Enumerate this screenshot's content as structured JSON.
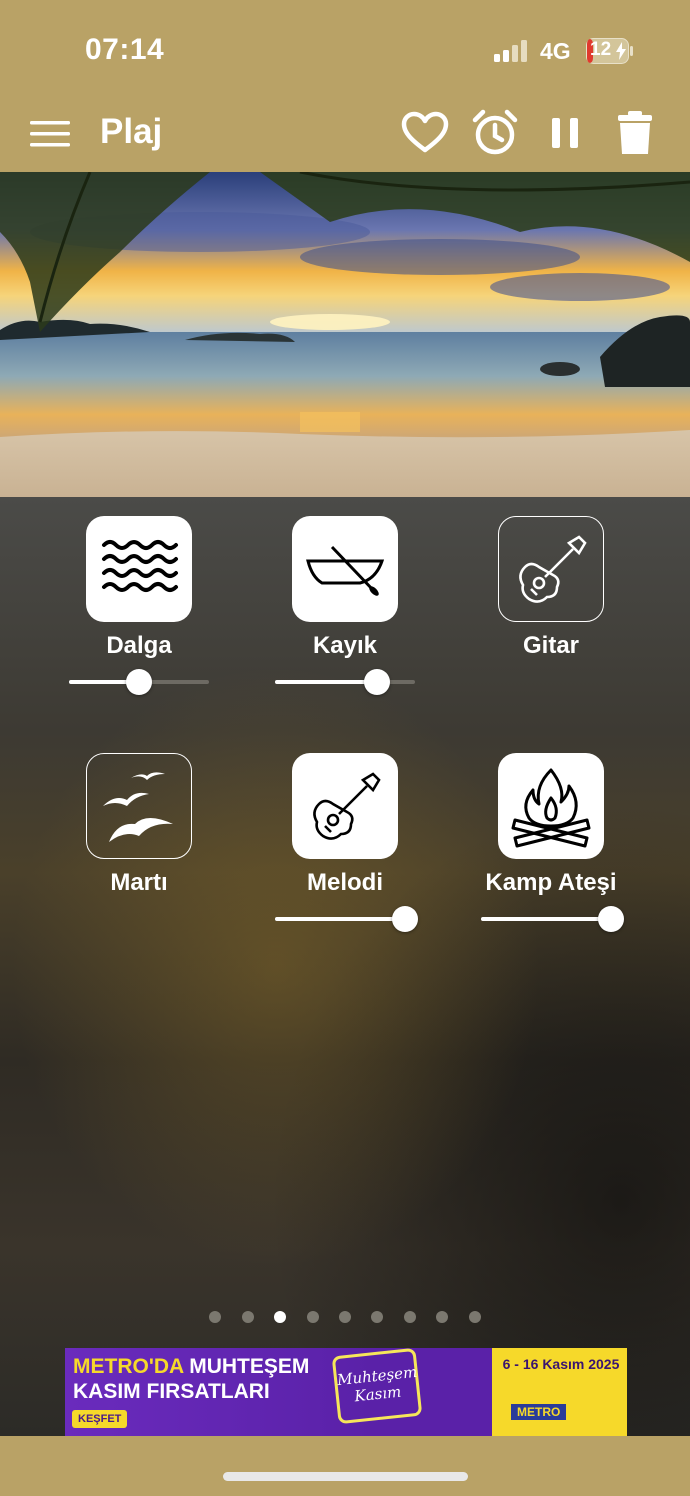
{
  "status_bar": {
    "time": "07:14",
    "network": "4G",
    "battery": "12"
  },
  "toolbar": {
    "title": "Plaj",
    "icons": [
      "menu-icon",
      "heart-icon",
      "alarm-icon",
      "pause-icon",
      "trash-icon"
    ]
  },
  "colors": {
    "bar": "#b9a266",
    "slider_track": "#6d6a63",
    "dot_inactive": "#7b786f"
  },
  "sounds": [
    {
      "label": "Dalga",
      "icon": "waves-icon",
      "active": true,
      "volume": 0.5
    },
    {
      "label": "Kayık",
      "icon": "boat-icon",
      "active": true,
      "volume": 0.73
    },
    {
      "label": "Gitar",
      "icon": "guitar-icon",
      "active": false,
      "volume": null
    },
    {
      "label": "Martı",
      "icon": "seagull-icon",
      "active": false,
      "volume": null
    },
    {
      "label": "Melodi",
      "icon": "guitar-icon",
      "active": true,
      "volume": 0.92
    },
    {
      "label": "Kamp Ateşi",
      "icon": "campfire-icon",
      "active": true,
      "volume": 0.92
    }
  ],
  "pagination": {
    "count": 9,
    "current": 3
  },
  "ad": {
    "line1_a": "METRO'DA ",
    "line1_b": "MUHTEŞEM",
    "line2": "KASIM FIRSATLARI",
    "cta": "KEŞFET",
    "badge": "Muhteşem Kasım",
    "date": "6 - 16 Kasım 2025",
    "brand": "METRO"
  }
}
